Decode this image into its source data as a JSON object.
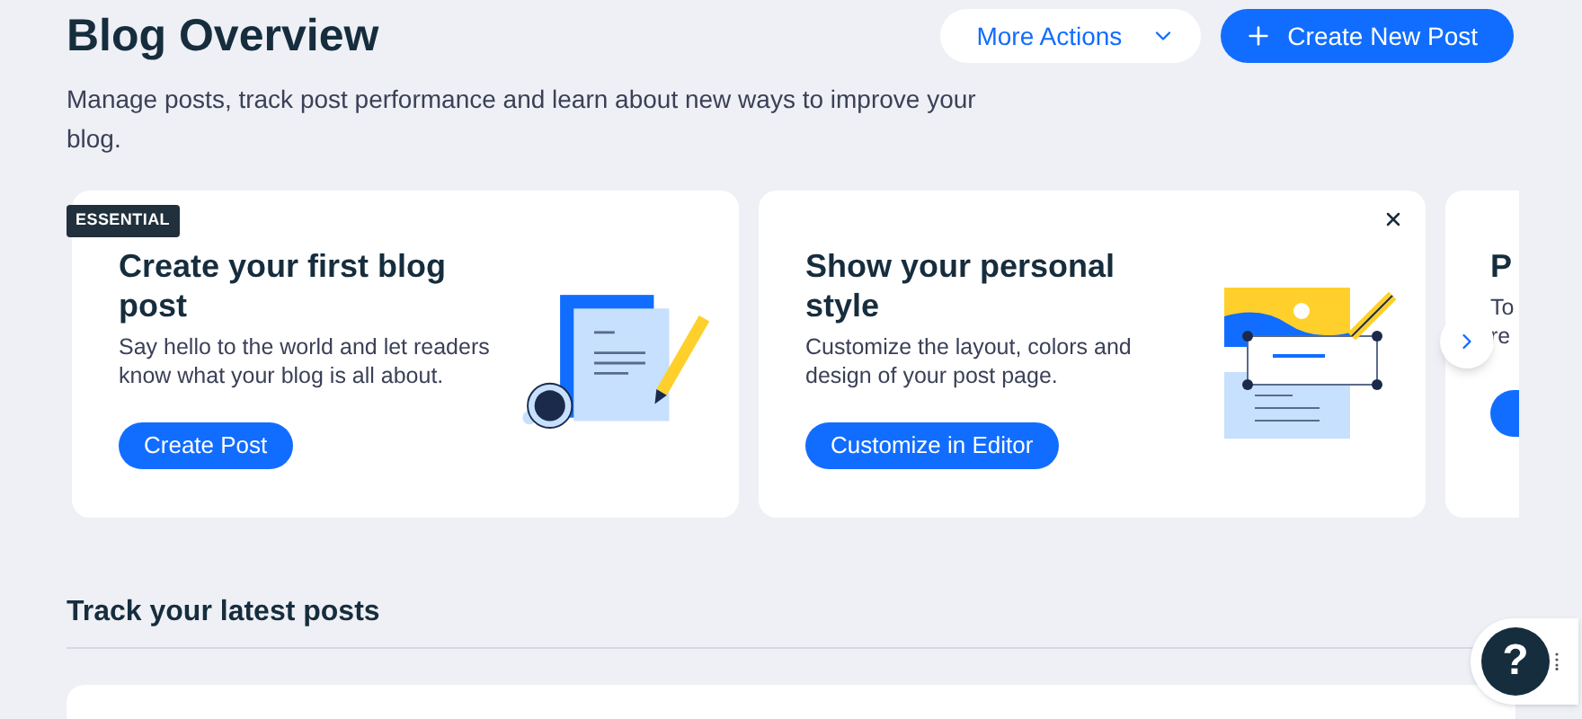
{
  "header": {
    "title": "Blog Overview",
    "description": "Manage posts, track post performance and learn about new ways to improve your blog.",
    "buttons": [
      {
        "label": "More Actions",
        "kind": "secondary"
      },
      {
        "label": "Create New Post",
        "kind": "primary"
      }
    ]
  },
  "cards": [
    {
      "badge": "ESSENTIAL",
      "title": "Create your first blog post",
      "text": "Say hello to the world and let readers know what your blog is all about.",
      "button": "Create Post",
      "kind": "document",
      "closable": false
    },
    {
      "title": "Show your personal style",
      "text": "Customize the layout, colors and design of your post page.",
      "button": "Customize in Editor",
      "kind": "layout",
      "closable": true
    },
    {
      "title": "P",
      "text_lines": [
        "To",
        "re"
      ]
    }
  ],
  "section": {
    "title": "Track your latest posts"
  },
  "help": {
    "label": "?"
  }
}
